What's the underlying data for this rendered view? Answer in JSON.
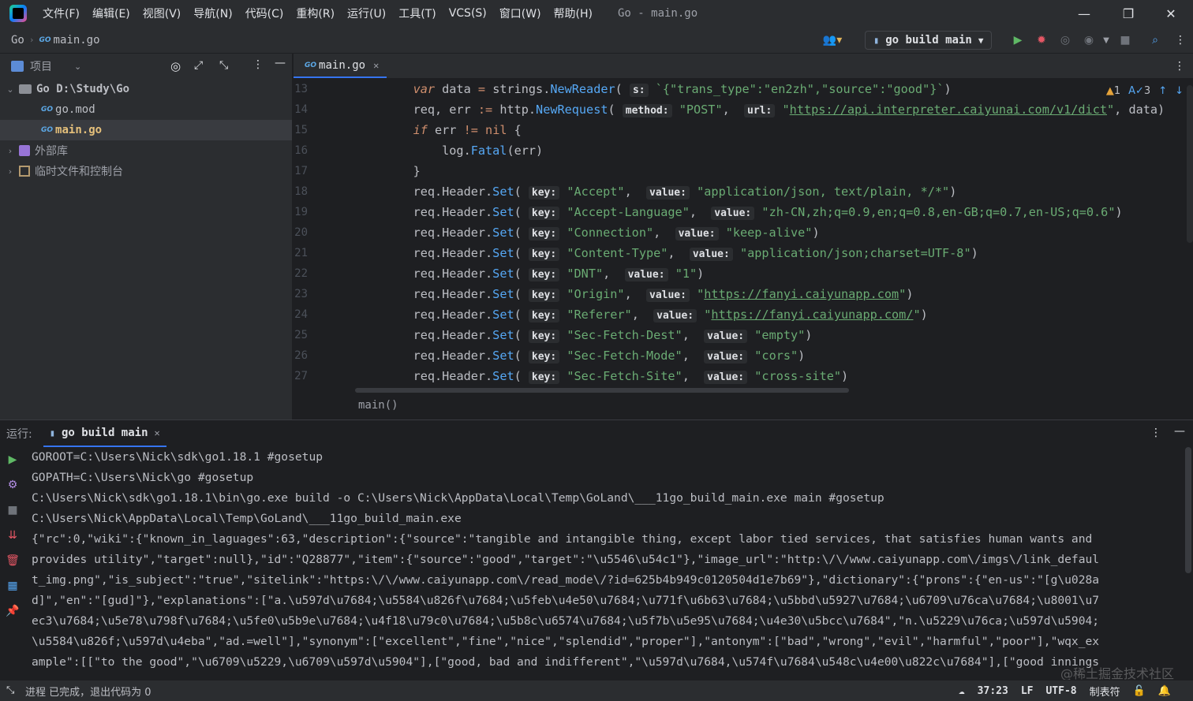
{
  "menubar": {
    "items": [
      "文件(F)",
      "编辑(E)",
      "视图(V)",
      "导航(N)",
      "代码(C)",
      "重构(R)",
      "运行(U)",
      "工具(T)",
      "VCS(S)",
      "窗口(W)",
      "帮助(H)"
    ],
    "window_title": "Go - main.go"
  },
  "navbar": {
    "breadcrumb_root": "Go",
    "breadcrumb_file": "main.go",
    "run_config": "go build main"
  },
  "project": {
    "header": "项目",
    "tree": [
      {
        "label": "Go  D:\\Study\\Go",
        "level": 0,
        "kind": "folder",
        "expanded": true
      },
      {
        "label": "go.mod",
        "level": 1,
        "kind": "gofile"
      },
      {
        "label": "main.go",
        "level": 1,
        "kind": "gofile",
        "selected": true
      },
      {
        "label": "外部库",
        "level": 0,
        "kind": "library"
      },
      {
        "label": "临时文件和控制台",
        "level": 0,
        "kind": "scratch"
      }
    ]
  },
  "editor": {
    "tab_label": "main.go",
    "inspection": {
      "warnings": "1",
      "typos": "3"
    },
    "line_numbers": [
      "13",
      "14",
      "15",
      "16",
      "17",
      "18",
      "19",
      "20",
      "21",
      "22",
      "23",
      "24",
      "25",
      "26",
      "27"
    ],
    "footer_breadcrumb": "main()",
    "lines": [
      {
        "indent": "    ",
        "pre": "",
        "kw": "var",
        "post": " data = strings.NewReader(",
        "hint": "s:",
        "str": "`{\"trans_type\":\"en2zh\",\"source\":\"good\"}`",
        "tail": ")"
      },
      {
        "text": "    req, err := http.NewRequest( method: \"POST\",  url: \"https://api.interpreter.caiyunai.com/v1/dict\", data)"
      },
      {
        "text": "    if err != nil {"
      },
      {
        "text": "        log.Fatal(err)"
      },
      {
        "text": "    }"
      },
      {
        "key": "Accept",
        "value": "application/json, text/plain, */*"
      },
      {
        "key": "Accept-Language",
        "value": "zh-CN,zh;q=0.9,en;q=0.8,en-GB;q=0.7,en-US;q=0.6"
      },
      {
        "key": "Connection",
        "value": "keep-alive"
      },
      {
        "key": "Content-Type",
        "value": "application/json;charset=UTF-8"
      },
      {
        "key": "DNT",
        "value": "1"
      },
      {
        "key": "Origin",
        "value": "https://fanyi.caiyunapp.com"
      },
      {
        "key": "Referer",
        "value": "https://fanyi.caiyunapp.com/"
      },
      {
        "key": "Sec-Fetch-Dest",
        "value": "empty"
      },
      {
        "key": "Sec-Fetch-Mode",
        "value": "cors"
      },
      {
        "key": "Sec-Fetch-Site",
        "value": "cross-site"
      }
    ],
    "snippets": {
      "req_prefix": "req",
      "header_set": ".Header.",
      "set_fn": "Set",
      "key_hint": "key:",
      "value_hint": "value:",
      "method_hint": "method:",
      "url_hint": "url:",
      "s_hint": "s:",
      "var_kw": "var",
      "if_kw": "if",
      "nil_kw": "nil",
      "api_url": "https://api.interpreter.caiyunai.com/v1/dict",
      "post_str": "\"POST\"",
      "reader_json": "`{\"trans_type\":\"en2zh\",\"source\":\"good\"}`"
    }
  },
  "run": {
    "label": "运行:",
    "tab": "go build main",
    "console": [
      "GOROOT=C:\\Users\\Nick\\sdk\\go1.18.1 #gosetup",
      "GOPATH=C:\\Users\\Nick\\go #gosetup",
      "C:\\Users\\Nick\\sdk\\go1.18.1\\bin\\go.exe build -o C:\\Users\\Nick\\AppData\\Local\\Temp\\GoLand\\___11go_build_main.exe main #gosetup",
      "C:\\Users\\Nick\\AppData\\Local\\Temp\\GoLand\\___11go_build_main.exe",
      "{\"rc\":0,\"wiki\":{\"known_in_laguages\":63,\"description\":{\"source\":\"tangible and intangible thing, except labor tied services, that satisfies human wants and",
      "provides utility\",\"target\":null},\"id\":\"Q28877\",\"item\":{\"source\":\"good\",\"target\":\"\\u5546\\u54c1\"},\"image_url\":\"http:\\/\\/www.caiyunapp.com\\/imgs\\/link_defaul",
      "t_img.png\",\"is_subject\":\"true\",\"sitelink\":\"https:\\/\\/www.caiyunapp.com\\/read_mode\\/?id=625b4b949c0120504d1e7b69\"},\"dictionary\":{\"prons\":{\"en-us\":\"[g\\u028a",
      "d]\",\"en\":\"[gud]\"},\"explanations\":[\"a.\\u597d\\u7684;\\u5584\\u826f\\u7684;\\u5feb\\u4e50\\u7684;\\u771f\\u6b63\\u7684;\\u5bbd\\u5927\\u7684;\\u6709\\u76ca\\u7684;\\u8001\\u7",
      "ec3\\u7684;\\u5e78\\u798f\\u7684;\\u5fe0\\u5b9e\\u7684;\\u4f18\\u79c0\\u7684;\\u5b8c\\u6574\\u7684;\\u5f7b\\u5e95\\u7684;\\u4e30\\u5bcc\\u7684\",\"n.\\u5229\\u76ca;\\u597d\\u5904;",
      "\\u5584\\u826f;\\u597d\\u4eba\",\"ad.=well\"],\"synonym\":[\"excellent\",\"fine\",\"nice\",\"splendid\",\"proper\"],\"antonym\":[\"bad\",\"wrong\",\"evil\",\"harmful\",\"poor\"],\"wqx_ex",
      "ample\":[[\"to the good\",\"\\u6709\\u5229,\\u6709\\u597d\\u5904\"],[\"good, bad and indifferent\",\"\\u597d\\u7684,\\u574f\\u7684\\u548c\\u4e00\\u822c\\u7684\"],[\"good innings"
    ]
  },
  "status": {
    "message": "进程 已完成，退出代码为 0",
    "position": "37:23",
    "line_sep": "LF",
    "encoding": "UTF-8",
    "indent": "制表符"
  },
  "watermark": "@稀土掘金技术社区",
  "colors": {
    "accent": "#3574f0",
    "string": "#6aab73",
    "keyword": "#cf8e6d",
    "function": "#56a8f5",
    "run_green": "#5fb865",
    "debug_red": "#e55765"
  }
}
